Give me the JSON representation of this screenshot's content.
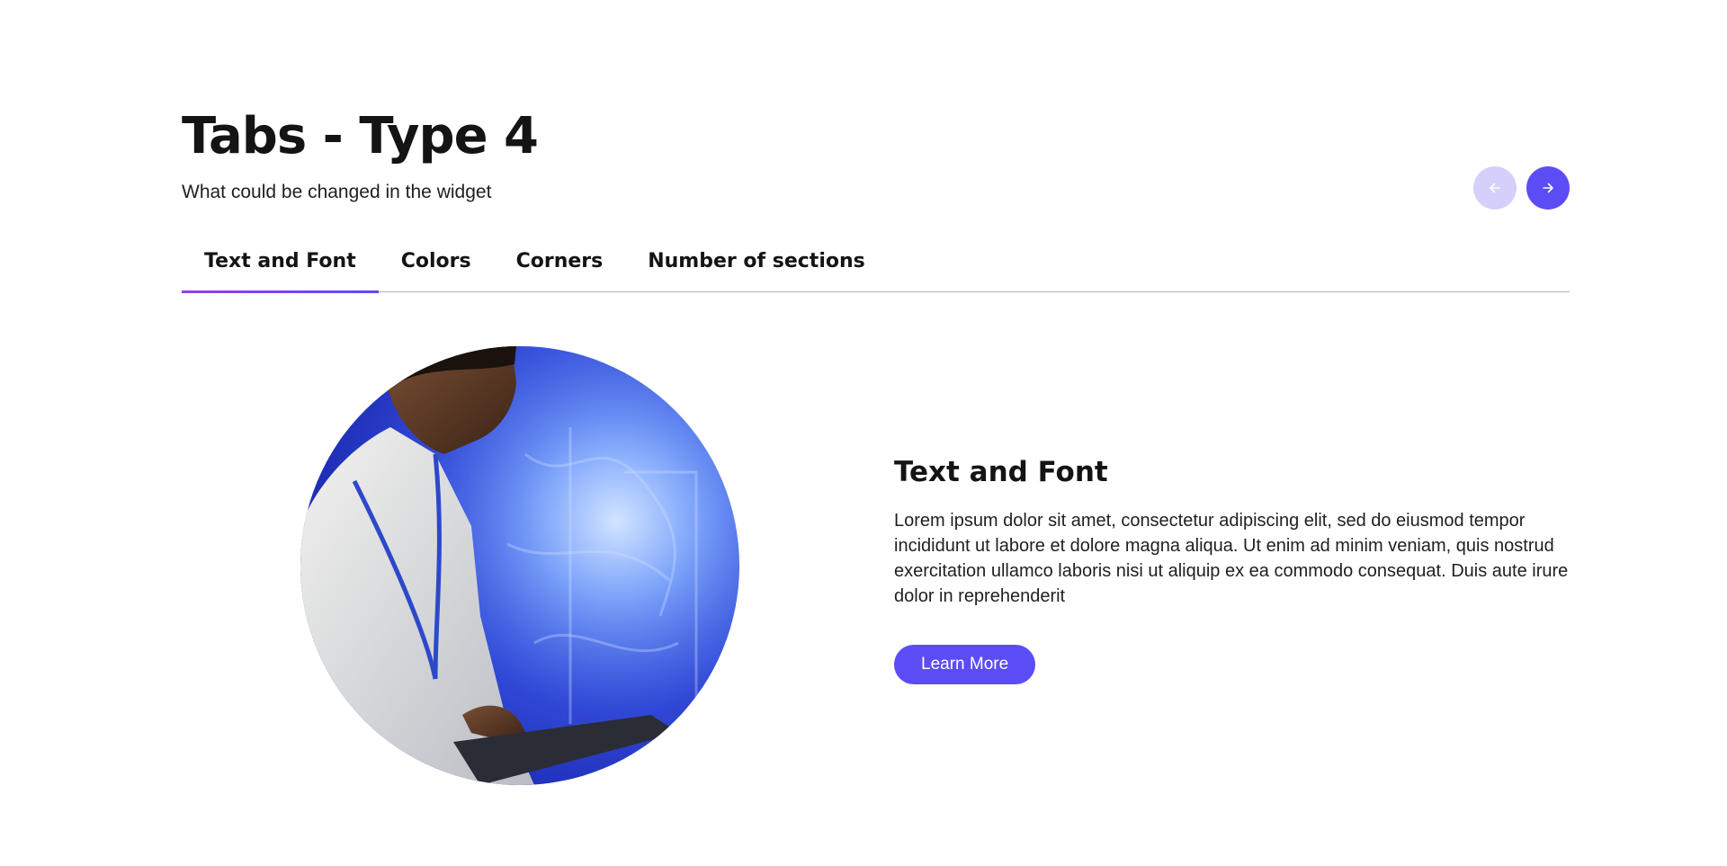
{
  "header": {
    "title": "Tabs - Type 4",
    "subtitle": "What could be changed in the widget"
  },
  "nav": {
    "prev_icon": "arrow-left-icon",
    "next_icon": "arrow-right-icon"
  },
  "tabs": [
    {
      "label": "Text and Font",
      "active": true
    },
    {
      "label": "Colors",
      "active": false
    },
    {
      "label": "Corners",
      "active": false
    },
    {
      "label": "Number of sections",
      "active": false
    }
  ],
  "panel": {
    "heading": "Text and Font",
    "body": "Lorem ipsum dolor sit amet, consectetur adipiscing elit, sed do eiusmod tempor incididunt ut labore et dolore magna aliqua. Ut enim ad minim veniam, quis nostrud exercitation ullamco laboris nisi ut aliquip ex ea commodo consequat. Duis aute irure dolor in reprehenderit",
    "cta_label": "Learn More"
  },
  "colors": {
    "accent": "#5b4cf5",
    "accent_light": "#d4d0fb",
    "tab_underline_start": "#9b3fd8",
    "tab_divider": "#aab4d8"
  }
}
